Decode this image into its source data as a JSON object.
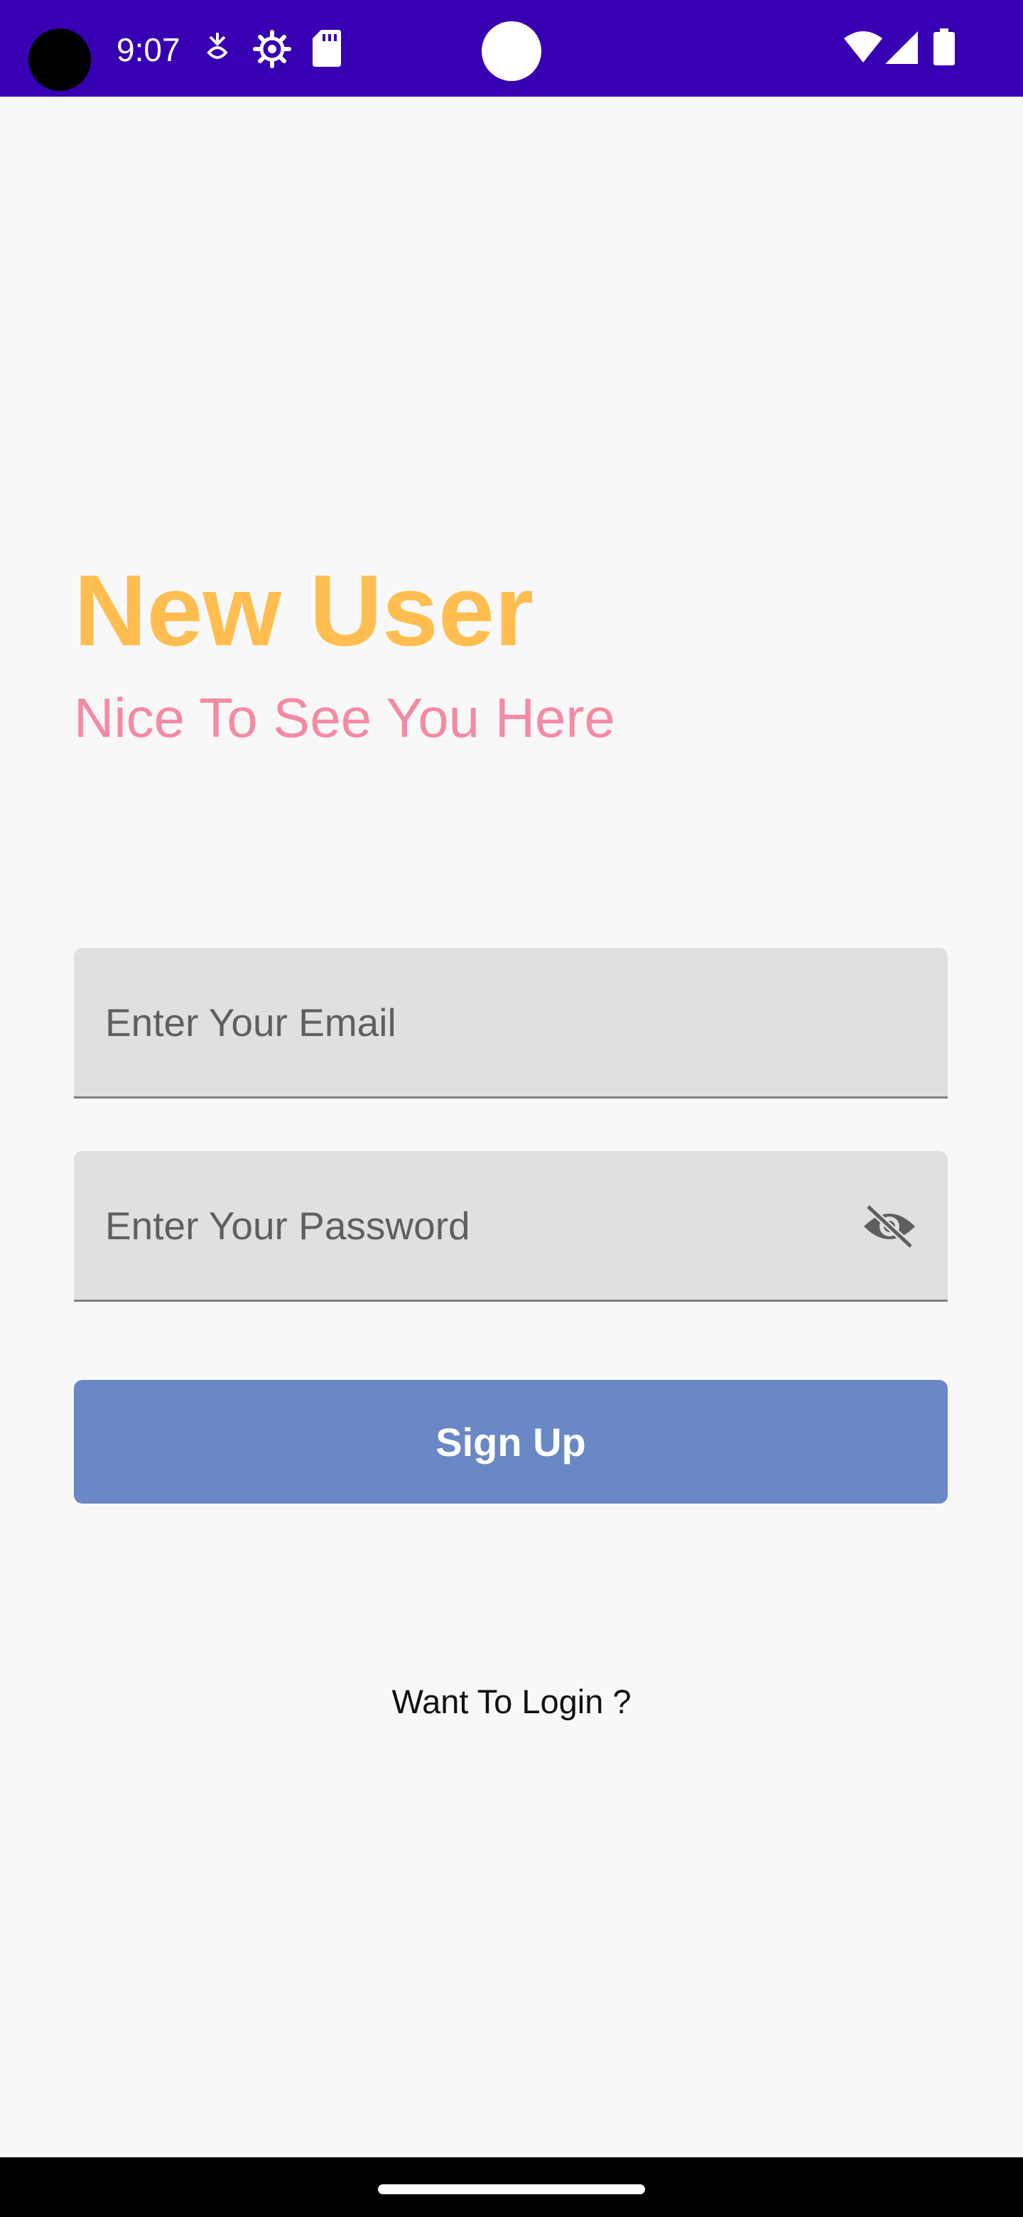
{
  "status_bar": {
    "time": "9:07",
    "color": "#3700b3",
    "icons": [
      "camera-cutout",
      "download-icon",
      "settings-gear-icon",
      "sd-card-icon",
      "wifi-icon",
      "cell-signal-icon",
      "battery-icon"
    ]
  },
  "header": {
    "title": "New User",
    "subtitle": "Nice To See You Here",
    "title_color": "#ffbe4f",
    "subtitle_color": "#f58aa3"
  },
  "form": {
    "email": {
      "value": "",
      "placeholder": "Enter Your Email"
    },
    "password": {
      "value": "",
      "placeholder": "Enter Your Password",
      "visibility_icon": "eye-off-icon"
    },
    "field_background": "#e0e0e0"
  },
  "actions": {
    "signup_label": "Sign Up",
    "signup_color": "#6a87c6",
    "login_prompt": "Want To Login ?"
  }
}
